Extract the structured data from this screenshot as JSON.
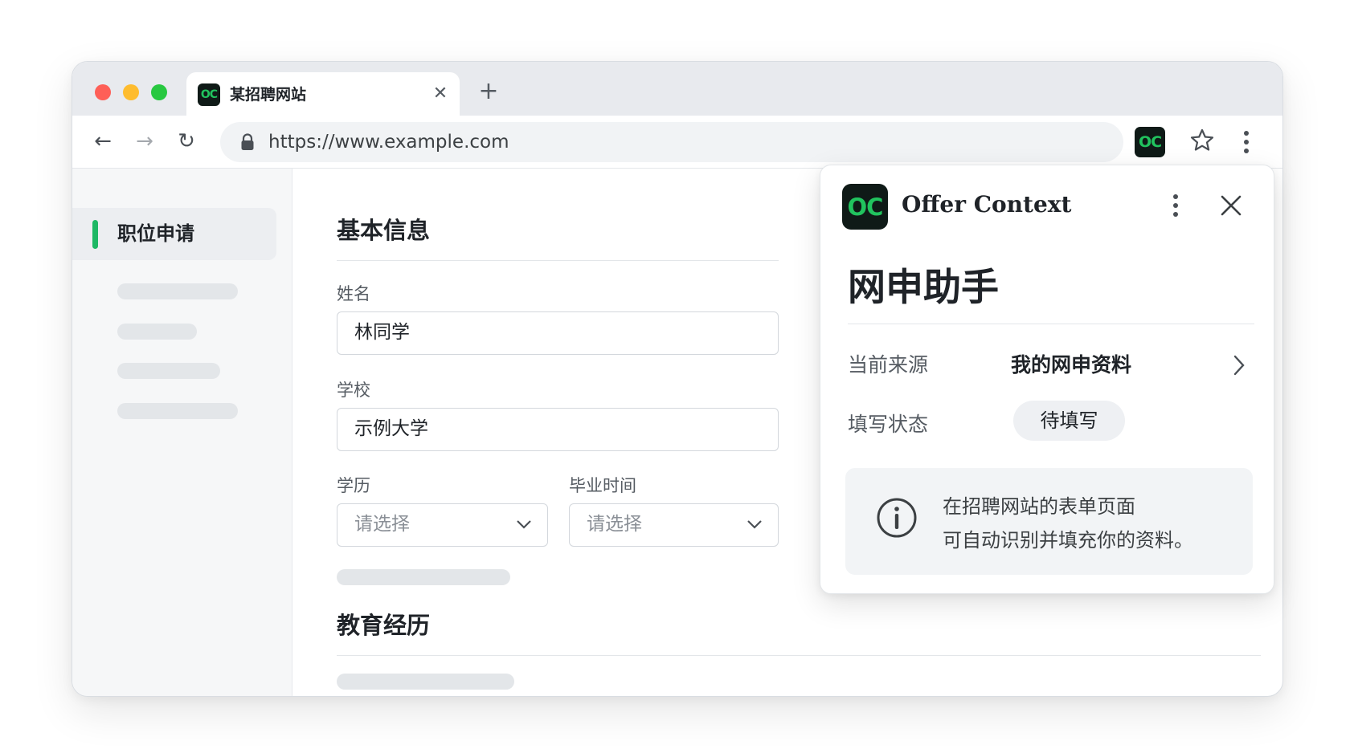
{
  "browser": {
    "tab_title": "某招聘网站",
    "tab_close": "✕",
    "new_tab": "+",
    "url": "https://www.example.com",
    "logo_text": "OC",
    "nav": {
      "back": "←",
      "forward": "→",
      "reload": "↻"
    }
  },
  "sidebar": {
    "active_item": "职位申请",
    "accent_color": "#1eb865"
  },
  "form": {
    "section_basic": "基本信息",
    "name_label": "姓名",
    "name_value": "林同学",
    "school_label": "学校",
    "school_value": "示例大学",
    "degree_label": "学历",
    "degree_placeholder": "请选择",
    "grad_label": "毕业时间",
    "grad_placeholder": "请选择",
    "section_education": "教育经历"
  },
  "extension_panel": {
    "logo_text": "OC",
    "brand": "Offer Context",
    "title": "网申助手",
    "source_label": "当前来源",
    "source_value": "我的网申资料",
    "status_label": "填写状态",
    "status_value": "待填写",
    "info_line1": "在招聘网站的表单页面",
    "info_line2": "可自动识别并填充你的资料。",
    "logo_bg": "#0f1a17",
    "logo_fg": "#21c35e"
  }
}
